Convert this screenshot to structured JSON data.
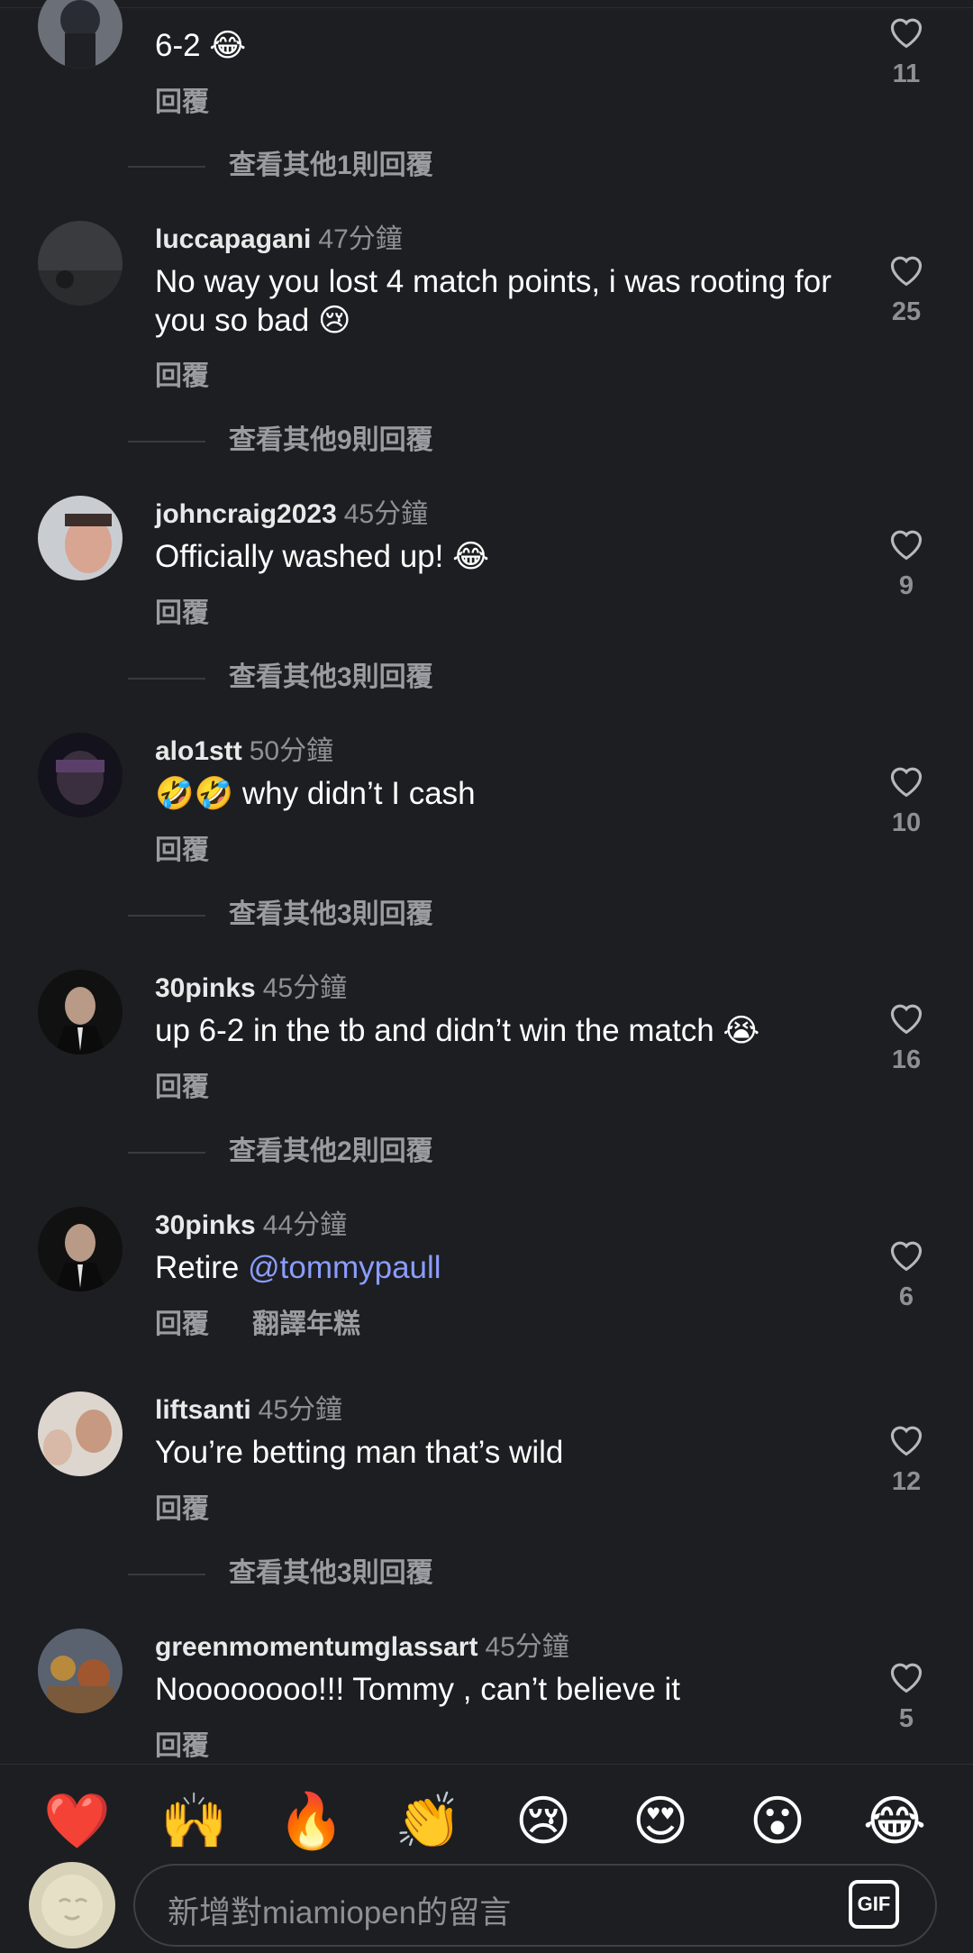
{
  "comments": [
    {
      "user": "",
      "time": "",
      "text": "6-2 😂",
      "reply": "回覆",
      "likes": "11",
      "more": "查看其他1則回覆"
    },
    {
      "user": "luccapagani",
      "time": "47分鐘",
      "text": "No way you lost 4 match points, i was rooting for you so bad 😢",
      "reply": "回覆",
      "likes": "25",
      "more": "查看其他9則回覆"
    },
    {
      "user": "johncraig2023",
      "time": "45分鐘",
      "text": "Officially washed up! 😂",
      "reply": "回覆",
      "likes": "9",
      "more": "查看其他3則回覆"
    },
    {
      "user": "alo1stt",
      "time": "50分鐘",
      "text": "🤣🤣 why didn’t I cash",
      "reply": "回覆",
      "likes": "10",
      "more": "查看其他3則回覆"
    },
    {
      "user": "30pinks",
      "time": "45分鐘",
      "text": "up 6-2 in the tb and didn’t win the match 😭",
      "reply": "回覆",
      "likes": "16",
      "more": "查看其他2則回覆"
    },
    {
      "user": "30pinks",
      "time": "44分鐘",
      "text_before": "Retire ",
      "mention": "@tommypaull",
      "reply": "回覆",
      "translate": "翻譯年糕",
      "likes": "6"
    },
    {
      "user": "liftsanti",
      "time": "45分鐘",
      "text": "You’re betting man that’s wild",
      "reply": "回覆",
      "likes": "12",
      "more": "查看其他3則回覆"
    },
    {
      "user": "greenmomentumglassart",
      "time": "45分鐘",
      "text": "Noooooooo!!! Tommy , can’t believe it",
      "reply": "回覆",
      "likes": "5"
    }
  ],
  "emoji_bar": [
    "❤️",
    "🙌",
    "🔥",
    "👏",
    "😢",
    "😍",
    "😮",
    "😂"
  ],
  "input": {
    "placeholder": "新增對miamiopen的留言",
    "gif_label": "GIF"
  },
  "colors": {
    "background": "#1d1e21",
    "mention": "#8b9dff",
    "muted": "#8f9096"
  }
}
